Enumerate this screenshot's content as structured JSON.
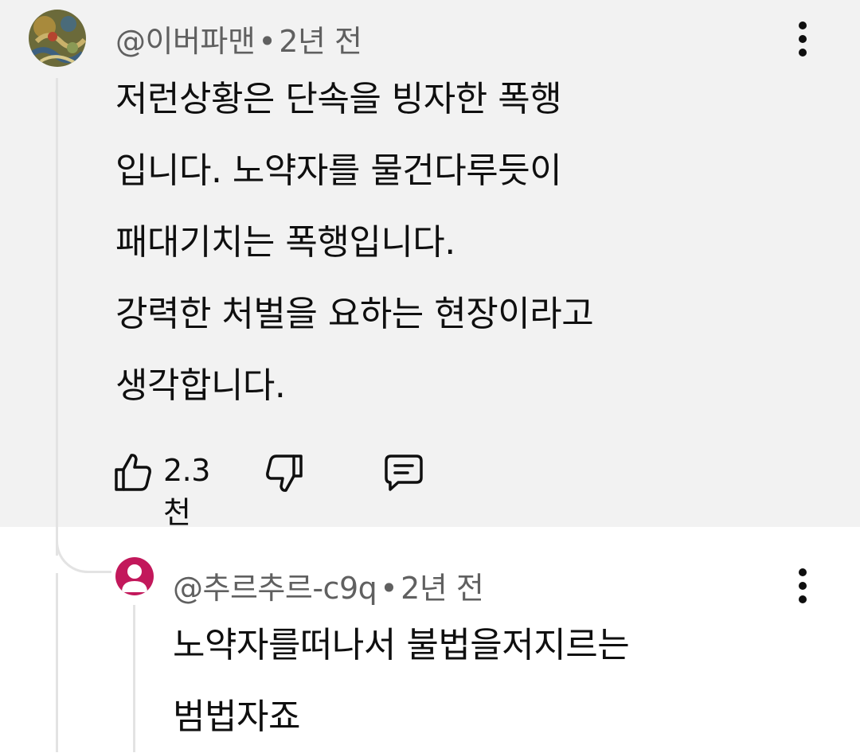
{
  "comment": {
    "author": "@이버파맨",
    "separator": "•",
    "time": "2년 전",
    "text": "저런상황은 단속을 빙자한 폭행\n입니다. 노약자를 물건다루듯이\n패대기치는 폭행입니다.\n강력한 처벌을 요하는 현장이라고\n생각합니다.",
    "like_count": "2.3천",
    "icons": {
      "like": "thumbs-up-icon",
      "dislike": "thumbs-down-icon",
      "reply": "comment-icon",
      "more": "more-vert-icon"
    }
  },
  "reply": {
    "author": "@추르추르-c9q",
    "separator": "•",
    "time": "2년 전",
    "text": "노약자를떠나서 불법을저지르는\n범법자죠",
    "avatar_color": "#c2185b"
  },
  "colors": {
    "highlight_bg": "#f2f2f2",
    "meta_text": "#606060",
    "thread_line": "#e3e3e3"
  }
}
